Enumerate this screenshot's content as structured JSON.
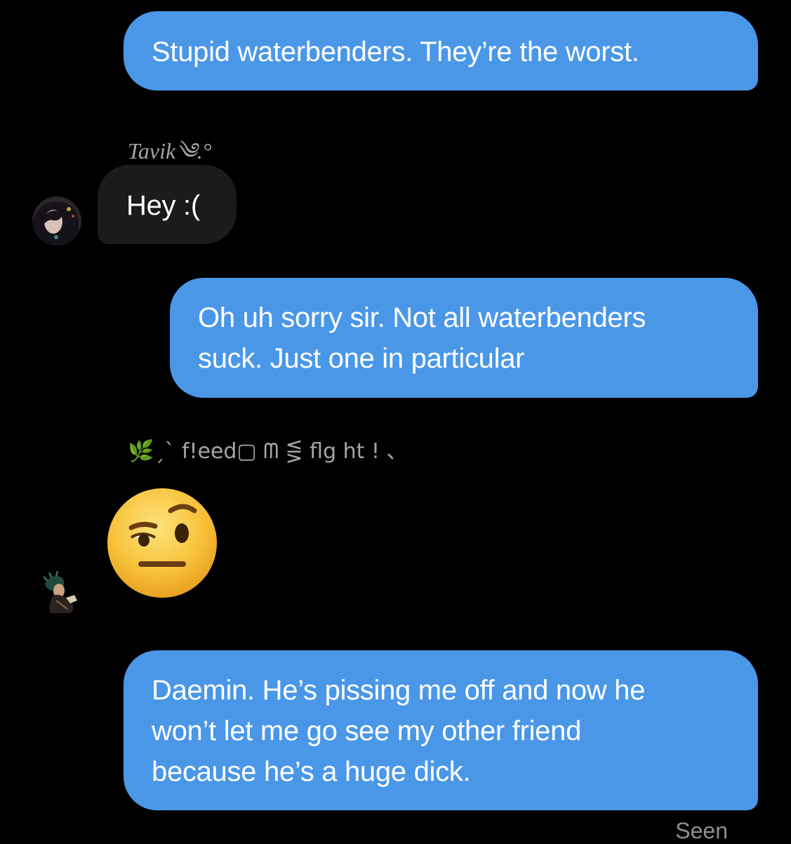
{
  "messages": [
    {
      "id": "m1",
      "direction": "outgoing",
      "text": "Stupid waterbenders. They’re the worst."
    },
    {
      "id": "m2",
      "direction": "incoming",
      "sender": "Tavik༄.°",
      "text": "Hey :("
    },
    {
      "id": "m3",
      "direction": "outgoing",
      "lines": [
        "Oh uh sorry sir. Not all waterbenders",
        "suck. Just one in particular"
      ]
    },
    {
      "id": "m4",
      "direction": "incoming",
      "sender": "🌿ˏˋ f!eed▢ ᗰ ⋚ flg ht ! 、",
      "emoji": "raised-eyebrow-face"
    },
    {
      "id": "m5",
      "direction": "outgoing",
      "lines": [
        "Daemin. He’s pissing me off and now he",
        "won’t let me go see my other friend",
        "because he’s a huge dick."
      ]
    }
  ],
  "status": {
    "seen_label": "Seen"
  },
  "colors": {
    "background": "#000000",
    "outgoing_bubble": "#4a97e8",
    "incoming_bubble": "#1b1b1d",
    "sender_name": "#a5a5a5",
    "seen_text": "#8e8e93",
    "emoji_face": "#f7c23a"
  }
}
